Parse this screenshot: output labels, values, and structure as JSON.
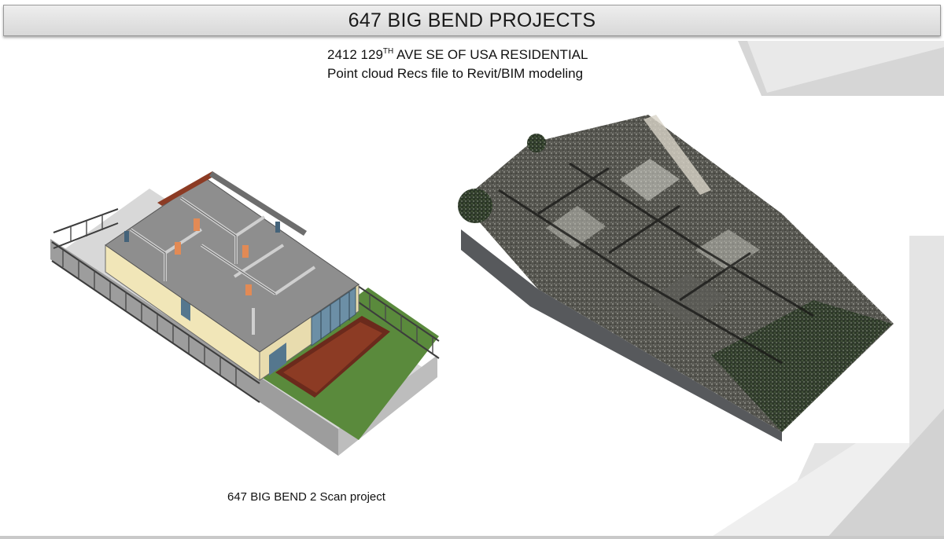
{
  "title": "647 BIG BEND PROJECTS",
  "subtitle": {
    "line1_prefix": "2412 129",
    "line1_sup": "TH",
    "line1_suffix": " AVE  SE OF USA  RESIDENTIAL",
    "line2": "Point cloud Recs file to Revit/BIM  modeling"
  },
  "caption": "647 BIG BEND 2 Scan project",
  "images": {
    "left": "revit-bim-model-isometric",
    "right": "point-cloud-scan-isometric"
  },
  "colors": {
    "title_bar": "#e2e2e2",
    "wall": "#f1e6b8",
    "floor": "#8e8e8e",
    "lawn": "#5a8a3c",
    "deck": "#6b2a1c",
    "fence": "#3c3c3c"
  }
}
